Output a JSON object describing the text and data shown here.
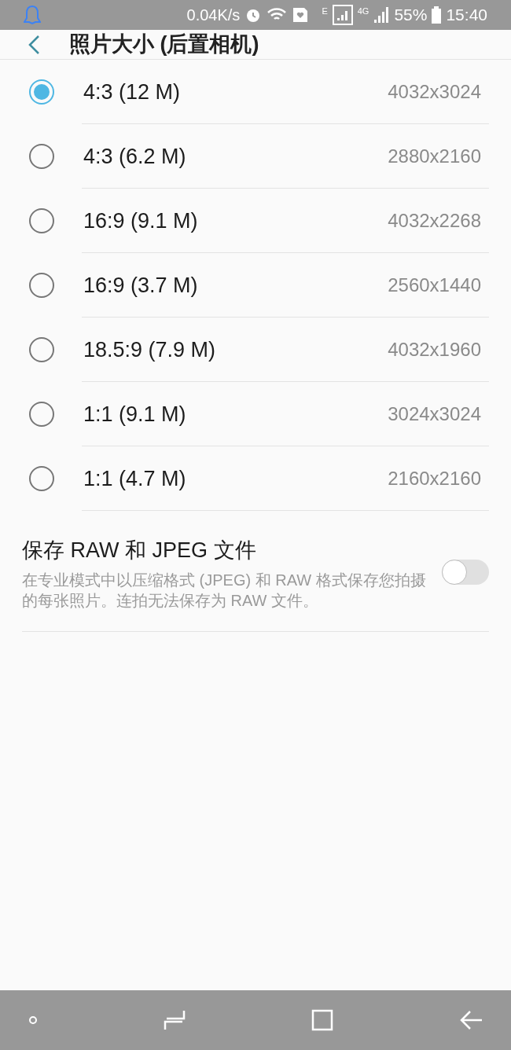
{
  "status_bar": {
    "speed": "0.04K/s",
    "network_1": "E",
    "network_2": "4G",
    "battery": "55%",
    "time": "15:40"
  },
  "header": {
    "title": "照片大小 (后置相机)"
  },
  "options": [
    {
      "label": "4:3 (12 M)",
      "resolution": "4032x3024",
      "selected": true
    },
    {
      "label": "4:3 (6.2 M)",
      "resolution": "2880x2160",
      "selected": false
    },
    {
      "label": "16:9 (9.1 M)",
      "resolution": "4032x2268",
      "selected": false
    },
    {
      "label": "16:9 (3.7 M)",
      "resolution": "2560x1440",
      "selected": false
    },
    {
      "label": "18.5:9 (7.9 M)",
      "resolution": "4032x1960",
      "selected": false
    },
    {
      "label": "1:1 (9.1 M)",
      "resolution": "3024x3024",
      "selected": false
    },
    {
      "label": "1:1 (4.7 M)",
      "resolution": "2160x2160",
      "selected": false
    }
  ],
  "raw_setting": {
    "title": "保存 RAW 和 JPEG 文件",
    "description": "在专业模式中以压缩格式 (JPEG) 和 RAW 格式保存您拍摄的每张照片。连拍无法保存为 RAW 文件。",
    "on": false
  }
}
